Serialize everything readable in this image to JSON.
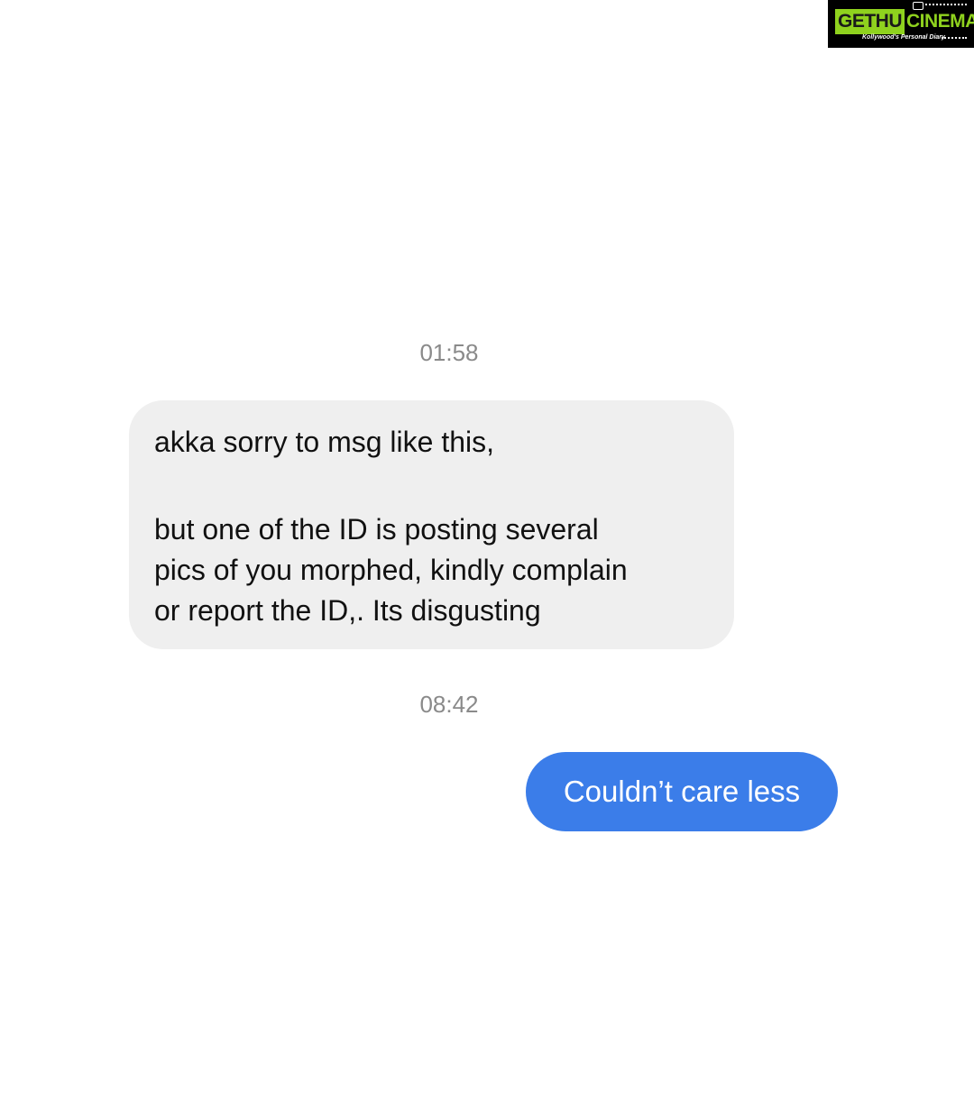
{
  "watermark": {
    "brand_part1": "GETHU",
    "brand_part2": "CINEMA",
    "tagline": "Kollywood's Personal Diary",
    "colors": {
      "accent": "#8fd21e",
      "background": "#000000"
    }
  },
  "conversation": {
    "messages": [
      {
        "timestamp": "01:58",
        "direction": "incoming",
        "lines": [
          "akka sorry to msg like this,",
          "but one of the ID is posting several",
          "pics of you morphed, kindly complain",
          "or report the ID,. Its disgusting"
        ]
      },
      {
        "timestamp": "08:42",
        "direction": "outgoing",
        "text": "Couldn’t care less"
      }
    ],
    "colors": {
      "incoming_bubble": "#efefef",
      "outgoing_bubble": "#3b7de9",
      "timestamp_text": "#8a8a8a"
    }
  }
}
